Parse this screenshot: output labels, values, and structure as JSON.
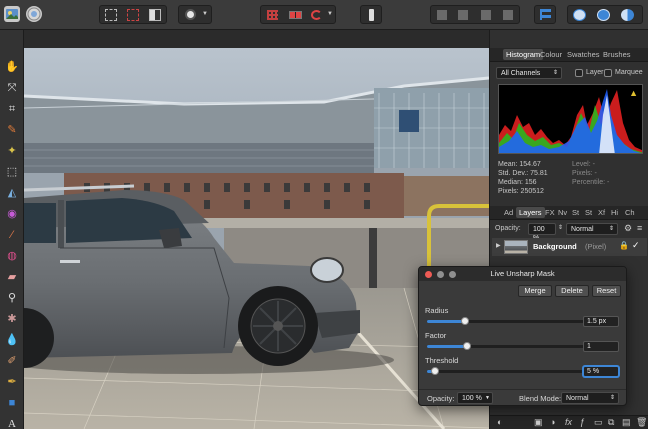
{
  "panel_tabs": {
    "histogram": "Histogram",
    "colour": "Colour",
    "swatches": "Swatches",
    "brushes": "Brushes"
  },
  "histogram": {
    "channel": "All Channels",
    "layer_label": "Layer",
    "marquee_label": "Marquee",
    "warning_icon": "warning-triangle-icon",
    "stats_left": [
      "Mean: 154.67",
      "Std. Dev.: 75.81",
      "Median: 156",
      "Pixels: 250512"
    ],
    "stats_right": [
      "Level: -",
      "Pixels: -",
      "Percentile: -"
    ]
  },
  "layers_tabs": {
    "ad": "Ad",
    "layers": "Layers",
    "fx": "FX",
    "nv": "Nv",
    "st": "St",
    "st2": "St",
    "xf": "Xf",
    "hi": "Hi",
    "ch": "Ch"
  },
  "layers": {
    "opacity_label": "Opacity:",
    "opacity_value": "100 %",
    "blend_value": "Normal",
    "layer_name": "Background",
    "layer_type": "(Pixel)"
  },
  "dialog": {
    "title": "Live Unsharp Mask",
    "merge": "Merge",
    "delete": "Delete",
    "reset": "Reset",
    "radius_label": "Radius",
    "radius_value": "1.5 px",
    "radius_level": 0.24,
    "factor_label": "Factor",
    "factor_value": "1",
    "factor_level": 0.25,
    "threshold_label": "Threshold",
    "threshold_value": "5 %",
    "threshold_level": 0.05,
    "opacity_label": "Opacity:",
    "opacity_value": "100 %",
    "blend_label": "Blend Mode:",
    "blend_value": "Normal"
  },
  "colors": {
    "accent": "#3d86d6",
    "close": "#ee5b55",
    "inactive_light": "#8f8f8f"
  }
}
